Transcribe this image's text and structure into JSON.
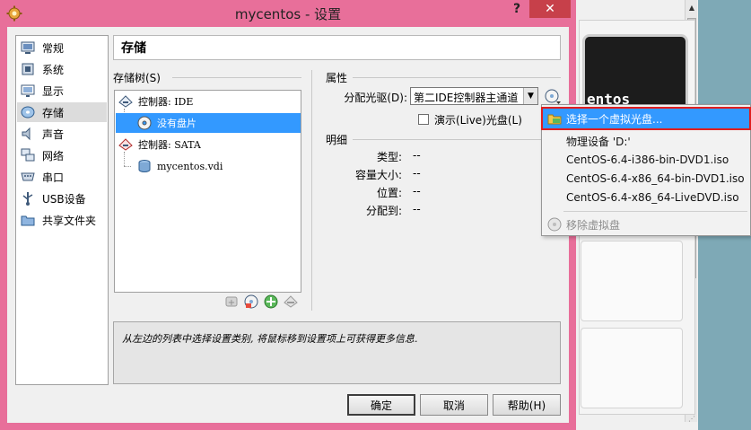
{
  "window": {
    "title": "mycentos - 设置",
    "help_glyph": "?",
    "close_glyph": "✕"
  },
  "sidebar": {
    "items": [
      {
        "label": "常规",
        "icon": "general-icon"
      },
      {
        "label": "系统",
        "icon": "system-icon"
      },
      {
        "label": "显示",
        "icon": "display-icon"
      },
      {
        "label": "存储",
        "icon": "storage-icon",
        "selected": true
      },
      {
        "label": "声音",
        "icon": "audio-icon"
      },
      {
        "label": "网络",
        "icon": "network-icon"
      },
      {
        "label": "串口",
        "icon": "serial-port-icon"
      },
      {
        "label": "USB设备",
        "icon": "usb-icon"
      },
      {
        "label": "共享文件夹",
        "icon": "shared-folder-icon"
      }
    ]
  },
  "page": {
    "title": "存储"
  },
  "storage_tree": {
    "label": "存储树(S)",
    "rows": [
      {
        "text": "控制器: IDE",
        "icon": "ide-controller-icon"
      },
      {
        "text": "没有盘片",
        "icon": "optical-disc-icon",
        "selected": true
      },
      {
        "text": "控制器: SATA",
        "icon": "sata-controller-icon"
      },
      {
        "text": "mycentos.vdi",
        "icon": "hard-disk-icon"
      }
    ],
    "toolbar_icons": [
      "add-controller-icon",
      "add-attachment-icon",
      "add-disk-icon",
      "remove-attachment-icon"
    ]
  },
  "attributes": {
    "label": "属性",
    "drive_label": "分配光驱(D):",
    "drive_value": "第二IDE控制器主通道",
    "live_label": "演示(Live)光盘(L)",
    "live_checked": false
  },
  "details": {
    "label": "明细",
    "rows": [
      {
        "key": "类型:",
        "value": "--"
      },
      {
        "key": "容量大小:",
        "value": "--"
      },
      {
        "key": "位置:",
        "value": "--"
      },
      {
        "key": "分配到:",
        "value": "--"
      }
    ]
  },
  "info": {
    "text": "从左边的列表中选择设置类别, 将鼠标移到设置项上可获得更多信息."
  },
  "buttons": {
    "ok": "确定",
    "cancel": "取消",
    "help": "帮助(H)"
  },
  "popup_menu": {
    "items": [
      {
        "label": "选择一个虚拟光盘...",
        "icon": "folder-icon",
        "highlighted": true
      },
      {
        "label": "物理设备 'D:'"
      },
      {
        "label": "CentOS-6.4-i386-bin-DVD1.iso"
      },
      {
        "label": "CentOS-6.4-x86_64-bin-DVD1.iso"
      },
      {
        "label": "CentOS-6.4-x86_64-LiveDVD.iso"
      },
      {
        "label": "移除虚拟盘",
        "icon": "remove-disk-icon",
        "disabled": true
      }
    ]
  },
  "background_window": {
    "preview_text": "entos"
  },
  "colors": {
    "title_bar": "#e86f9a",
    "selection": "#3399ff",
    "close_button": "#c7404a",
    "highlight_outline": "#e01e1e"
  }
}
